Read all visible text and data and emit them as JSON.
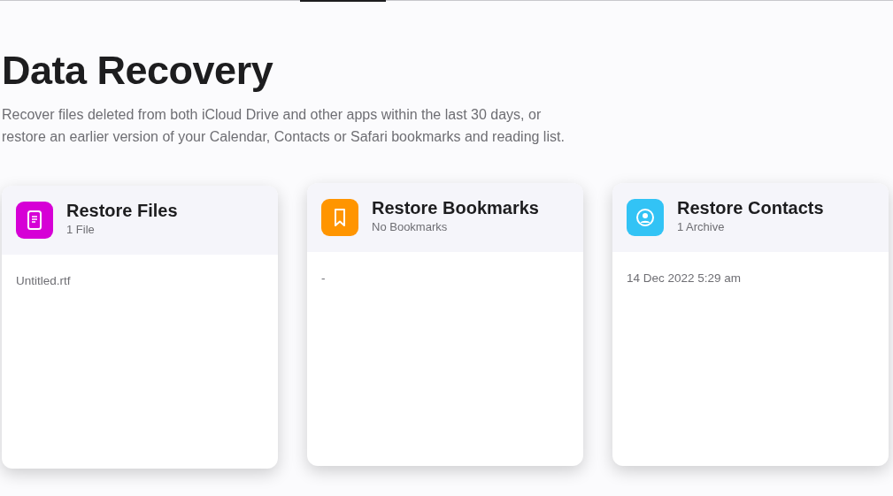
{
  "page": {
    "title": "Data Recovery",
    "description": "Recover files deleted from both iCloud Drive and other apps within the last 30 days, or restore an earlier version of your Calendar, Contacts or Safari bookmarks and reading list."
  },
  "cards": [
    {
      "kind": "file",
      "color": "#d600d6",
      "title": "Restore Files",
      "subtitle": "1 File",
      "items": [
        "Untitled.rtf"
      ]
    },
    {
      "kind": "bookmark",
      "color": "#ff9500",
      "title": "Restore Bookmarks",
      "subtitle": "No Bookmarks",
      "items": [
        "-"
      ]
    },
    {
      "kind": "contact",
      "color": "#32c3f5",
      "title": "Restore Contacts",
      "subtitle": "1 Archive",
      "items": [
        "14 Dec 2022 5:29 am"
      ]
    }
  ]
}
